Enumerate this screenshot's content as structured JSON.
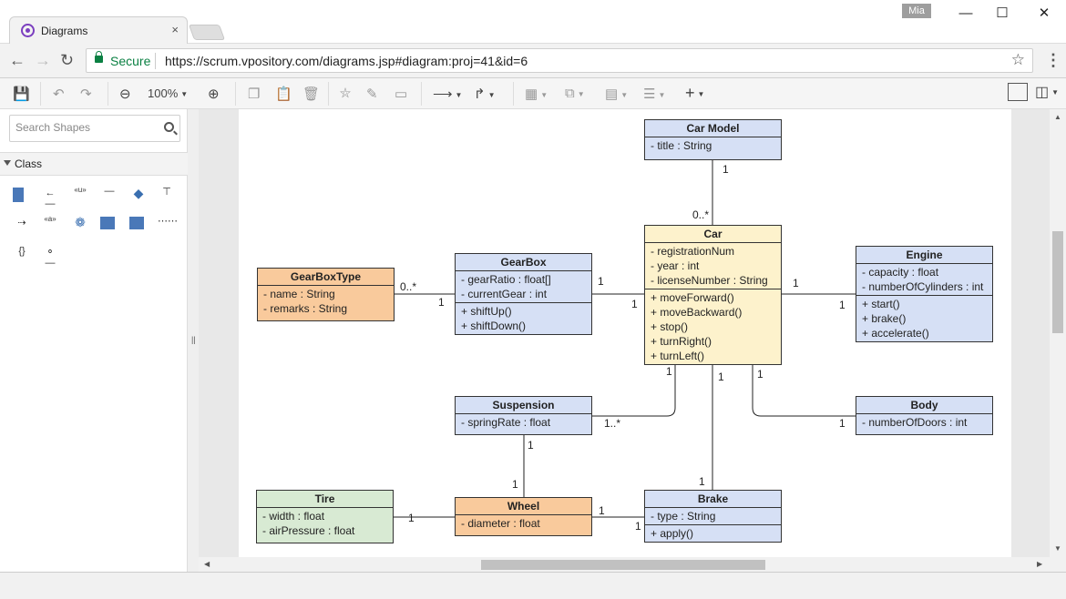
{
  "browser": {
    "tab_title": "Diagrams",
    "tab_close": "×",
    "user": "Mia",
    "secure_label": "Secure",
    "url": "https://scrum.vpository.com/diagrams.jsp#diagram:proj=41&id=6"
  },
  "toolbar": {
    "zoom": "100%"
  },
  "left_panel": {
    "search_placeholder": "Search Shapes",
    "section_label": "Class"
  },
  "diagram": {
    "classes": {
      "car_model": {
        "name": "Car Model",
        "attributes": [
          "- title : String"
        ],
        "operations": []
      },
      "car": {
        "name": "Car",
        "attributes": [
          "- registrationNum",
          "- year : int",
          "- licenseNumber : String"
        ],
        "operations": [
          "+ moveForward()",
          "+ moveBackward()",
          "+ stop()",
          "+ turnRight()",
          "+ turnLeft()"
        ]
      },
      "gearbox_type": {
        "name": "GearBoxType",
        "attributes": [
          "- name : String",
          "- remarks : String"
        ],
        "operations": []
      },
      "gearbox": {
        "name": "GearBox",
        "attributes": [
          "- gearRatio : float[]",
          "- currentGear : int"
        ],
        "operations": [
          "+ shiftUp()",
          "+ shiftDown()"
        ]
      },
      "engine": {
        "name": "Engine",
        "attributes": [
          "- capacity : float",
          "- numberOfCylinders : int"
        ],
        "operations": [
          "+ start()",
          "+ brake()",
          "+ accelerate()"
        ]
      },
      "suspension": {
        "name": "Suspension",
        "attributes": [
          "- springRate : float"
        ],
        "operations": []
      },
      "body": {
        "name": "Body",
        "attributes": [
          "- numberOfDoors : int"
        ],
        "operations": []
      },
      "tire": {
        "name": "Tire",
        "attributes": [
          "- width : float",
          "- airPressure : float"
        ],
        "operations": []
      },
      "wheel": {
        "name": "Wheel",
        "attributes": [
          "- diameter : float"
        ],
        "operations": []
      },
      "brake": {
        "name": "Brake",
        "attributes": [
          "- type : String"
        ],
        "operations": [
          "+ apply()"
        ]
      }
    },
    "multiplicities": {
      "carmodel_top": "1",
      "car_from_model": "0..*",
      "gbt_end": "0..*",
      "gb_from_gbt": "1",
      "gb_to_car": "1",
      "car_from_gb": "1",
      "car_to_engine": "1",
      "engine_from_car": "1",
      "car_to_susp": "1",
      "susp_from_car": "1..*",
      "car_to_brake": "1",
      "car_to_body": "1",
      "body_from_car": "1",
      "susp_to_wheel": "1",
      "wheel_from_susp": "1",
      "brake_from_car": "1",
      "tire_to_wheel": "1",
      "wheel_to_brake": "1",
      "brake_from_wheel": "1"
    }
  }
}
